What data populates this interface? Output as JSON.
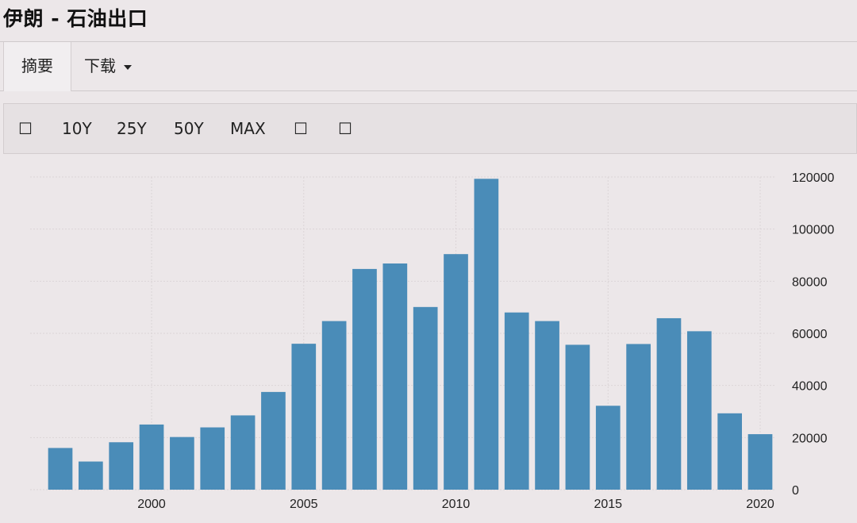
{
  "page": {
    "title": "伊朗 - 石油出口"
  },
  "tabs": {
    "summary": "摘要",
    "download": "下载"
  },
  "toolbar": {
    "items": [
      {
        "label": "☐"
      },
      {
        "label": "10Y"
      },
      {
        "label": "25Y"
      },
      {
        "label": "50Y"
      },
      {
        "label": "MAX"
      },
      {
        "label": "☐"
      },
      {
        "label": "☐"
      }
    ]
  },
  "colors": {
    "bar": "#4a8cb8",
    "background": "#ece7e9"
  },
  "chart_data": {
    "type": "bar",
    "title": "",
    "xlabel": "",
    "ylabel": "",
    "x": [
      1997,
      1998,
      1999,
      2000,
      2001,
      2002,
      2003,
      2004,
      2005,
      2006,
      2007,
      2008,
      2009,
      2010,
      2011,
      2012,
      2013,
      2014,
      2015,
      2016,
      2017,
      2018,
      2019,
      2020
    ],
    "values": [
      16000,
      10800,
      18200,
      25000,
      20200,
      23900,
      28500,
      37500,
      56000,
      64700,
      84700,
      86800,
      70100,
      90400,
      119300,
      68000,
      64700,
      55600,
      32200,
      55900,
      65800,
      60800,
      29300,
      21300
    ],
    "ylim": [
      0,
      120000
    ],
    "yticks": [
      0,
      20000,
      40000,
      60000,
      80000,
      100000,
      120000
    ],
    "xticks": [
      2000,
      2005,
      2010,
      2015,
      2020
    ],
    "grid": true,
    "yaxis_position": "right"
  }
}
